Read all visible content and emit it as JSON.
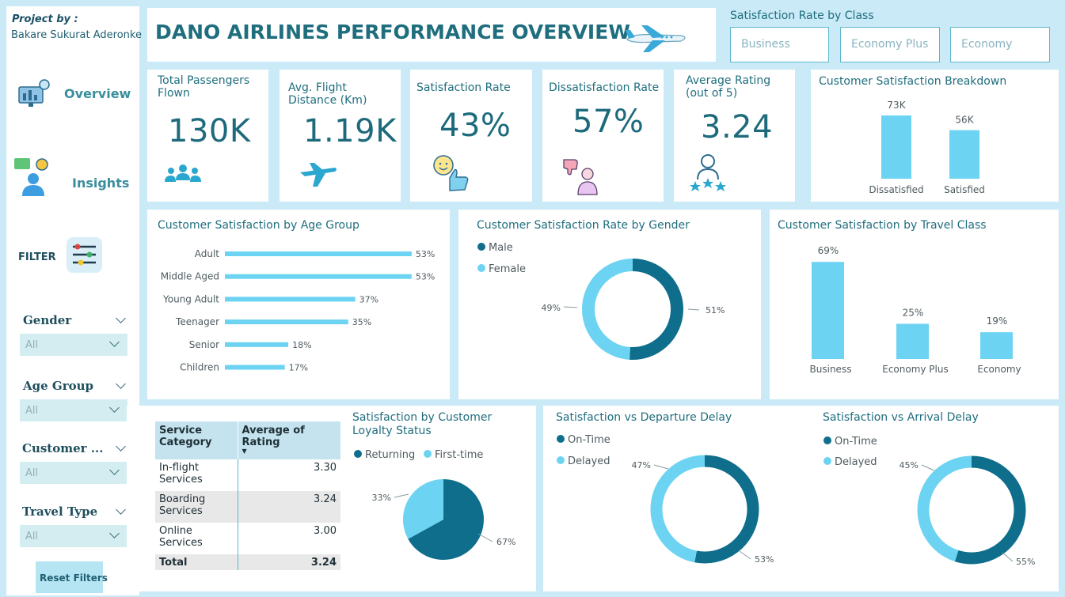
{
  "sidebar": {
    "project_by_label": "Project by :",
    "author": "Bakare Sukurat Aderonke",
    "nav": [
      {
        "label": "Overview"
      },
      {
        "label": "Insights"
      }
    ],
    "filter_label": "FILTER",
    "slicers": [
      {
        "label": "Gender",
        "value": "All"
      },
      {
        "label": "Age Group",
        "value": "All"
      },
      {
        "label": "Customer ...",
        "value": "All"
      },
      {
        "label": "Travel Type",
        "value": "All"
      }
    ],
    "reset_label": "Reset Filters"
  },
  "header": {
    "title": "DANO AIRLINES PERFORMANCE OVERVIEW"
  },
  "class_filter": {
    "title": "Satisfaction Rate by Class",
    "options": [
      "Business",
      "Economy Plus",
      "Economy"
    ]
  },
  "kpis": [
    {
      "title": "Total Passengers Flown",
      "value": "130K",
      "icon": "people-icon"
    },
    {
      "title": "Avg. Flight Distance (Km)",
      "value": "1.19K",
      "icon": "airplane-icon"
    },
    {
      "title": "Satisfaction Rate",
      "value": "43%",
      "icon": "thumbs-up-icon"
    },
    {
      "title": "Dissatisfaction Rate",
      "value": "57%",
      "icon": "thumbs-down-icon"
    },
    {
      "title": "Average Rating (out of 5)",
      "value": "3.24",
      "icon": "star-rating-icon"
    }
  ],
  "colors": {
    "light": "#6dd3f2",
    "dark": "#0f6e8c",
    "text": "#1f6e7e",
    "bg": "#c9eaf6"
  },
  "chart_data": [
    {
      "id": "breakdown",
      "type": "bar",
      "title": "Customer Satisfaction Breakdown",
      "categories": [
        "Dissatisfied",
        "Satisfied"
      ],
      "values": [
        73000,
        56000
      ],
      "labels": [
        "73K",
        "56K"
      ]
    },
    {
      "id": "age",
      "type": "bar",
      "orientation": "horizontal",
      "title": "Customer Satisfaction by Age Group",
      "categories": [
        "Adult",
        "Middle Aged",
        "Young Adult",
        "Teenager",
        "Senior",
        "Children"
      ],
      "values": [
        53,
        53,
        37,
        35,
        18,
        17
      ],
      "labels": [
        "53%",
        "53%",
        "37%",
        "35%",
        "18%",
        "17%"
      ]
    },
    {
      "id": "gender",
      "type": "pie",
      "donut": true,
      "title": "Customer Satisfaction Rate by Gender",
      "series": [
        {
          "name": "Male",
          "value": 51,
          "label": "51%"
        },
        {
          "name": "Female",
          "value": 49,
          "label": "49%"
        }
      ]
    },
    {
      "id": "travel_class",
      "type": "bar",
      "title": "Customer Satisfaction by Travel Class",
      "categories": [
        "Business",
        "Economy Plus",
        "Economy"
      ],
      "values": [
        69,
        25,
        19
      ],
      "labels": [
        "69%",
        "25%",
        "19%"
      ]
    },
    {
      "id": "service_table",
      "type": "table",
      "columns": [
        "Service Category",
        "Average of Rating"
      ],
      "rows": [
        [
          "In-flight Services",
          "3.30"
        ],
        [
          "Boarding Services",
          "3.24"
        ],
        [
          "Online Services",
          "3.00"
        ]
      ],
      "total": [
        "Total",
        "3.24"
      ]
    },
    {
      "id": "loyalty",
      "type": "pie",
      "title": "Satisfaction by Customer Loyalty Status",
      "series": [
        {
          "name": "Returning",
          "value": 67,
          "label": "67%"
        },
        {
          "name": "First-time",
          "value": 33,
          "label": "33%"
        }
      ]
    },
    {
      "id": "departure",
      "type": "pie",
      "donut": true,
      "title": "Satisfaction vs Departure Delay",
      "series": [
        {
          "name": "On-Time",
          "value": 53,
          "label": "53%"
        },
        {
          "name": "Delayed",
          "value": 47,
          "label": "47%"
        }
      ]
    },
    {
      "id": "arrival",
      "type": "pie",
      "donut": true,
      "title": "Satisfaction vs Arrival Delay",
      "series": [
        {
          "name": "On-Time",
          "value": 55,
          "label": "55%"
        },
        {
          "name": "Delayed",
          "value": 45,
          "label": "45%"
        }
      ]
    }
  ]
}
